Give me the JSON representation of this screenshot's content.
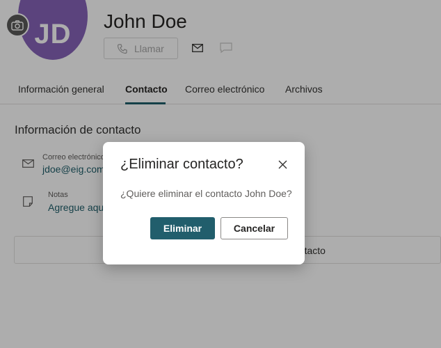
{
  "contact": {
    "initials": "JD",
    "name": "John Doe",
    "call_label": "Llamar"
  },
  "tabs": [
    {
      "label": "Información general"
    },
    {
      "label": "Contacto"
    },
    {
      "label": "Correo electrónico"
    },
    {
      "label": "Archivos"
    }
  ],
  "contact_info": {
    "title": "Información de contacto",
    "email_label": "Correo electrónico",
    "email_value": "jdoe@eig.com",
    "notes_label": "Notas",
    "notes_placeholder": "Agregue aquí notas",
    "add_card_label": "ontacto"
  },
  "dialog": {
    "title": "¿Eliminar contacto?",
    "message": "¿Quiere eliminar el contacto John Doe?",
    "confirm_label": "Eliminar",
    "cancel_label": "Cancelar"
  },
  "colors": {
    "avatar": "#8764b8",
    "accent": "#215e6c",
    "link": "#1f5f6b"
  }
}
